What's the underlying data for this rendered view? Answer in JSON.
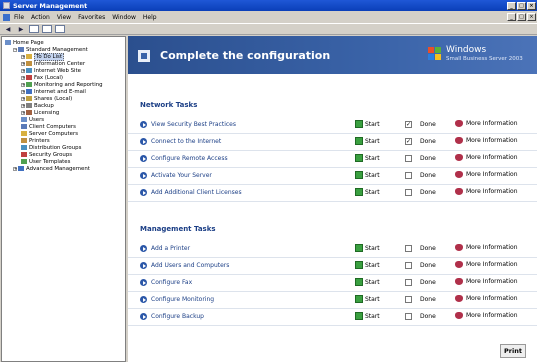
{
  "window": {
    "title": "Server Management"
  },
  "menu": [
    "File",
    "Action",
    "View",
    "Favorites",
    "Window",
    "Help"
  ],
  "tree": {
    "items": [
      {
        "label": "Home Page",
        "level": 0
      },
      {
        "label": "Standard Management",
        "level": 1
      },
      {
        "label": "To Do List",
        "level": 2,
        "selected": true
      },
      {
        "label": "Information Center",
        "level": 2
      },
      {
        "label": "Internet Web Site",
        "level": 2
      },
      {
        "label": "Fax (Local)",
        "level": 2
      },
      {
        "label": "Monitoring and Reporting",
        "level": 2
      },
      {
        "label": "Internet and E-mail",
        "level": 2
      },
      {
        "label": "Shares (Local)",
        "level": 2
      },
      {
        "label": "Backup",
        "level": 2
      },
      {
        "label": "Licensing",
        "level": 2
      },
      {
        "label": "Users",
        "level": 2
      },
      {
        "label": "Client Computers",
        "level": 2
      },
      {
        "label": "Server Computers",
        "level": 2
      },
      {
        "label": "Printers",
        "level": 2
      },
      {
        "label": "Distribution Groups",
        "level": 2
      },
      {
        "label": "Security Groups",
        "level": 2
      },
      {
        "label": "User Templates",
        "level": 2
      },
      {
        "label": "Advanced Management",
        "level": 1
      }
    ]
  },
  "banner": {
    "title": "Complete the configuration",
    "logo_line1": "Windows",
    "logo_line2": "Small Business Server 2003"
  },
  "sections": [
    {
      "title": "Network Tasks",
      "tasks": [
        {
          "label": "View Security Best Practices",
          "done": true
        },
        {
          "label": "Connect to the Internet",
          "done": true
        },
        {
          "label": "Configure Remote Access",
          "done": false
        },
        {
          "label": "Activate Your Server",
          "done": false
        },
        {
          "label": "Add Additional Client Licenses",
          "done": false
        }
      ]
    },
    {
      "title": "Management Tasks",
      "tasks": [
        {
          "label": "Add a Printer",
          "done": false
        },
        {
          "label": "Add Users and Computers",
          "done": false
        },
        {
          "label": "Configure Fax",
          "done": false
        },
        {
          "label": "Configure Monitoring",
          "done": false
        },
        {
          "label": "Configure Backup",
          "done": false
        }
      ]
    }
  ],
  "labels": {
    "start": "Start",
    "done": "Done",
    "more_info": "More Information",
    "print": "Print"
  }
}
